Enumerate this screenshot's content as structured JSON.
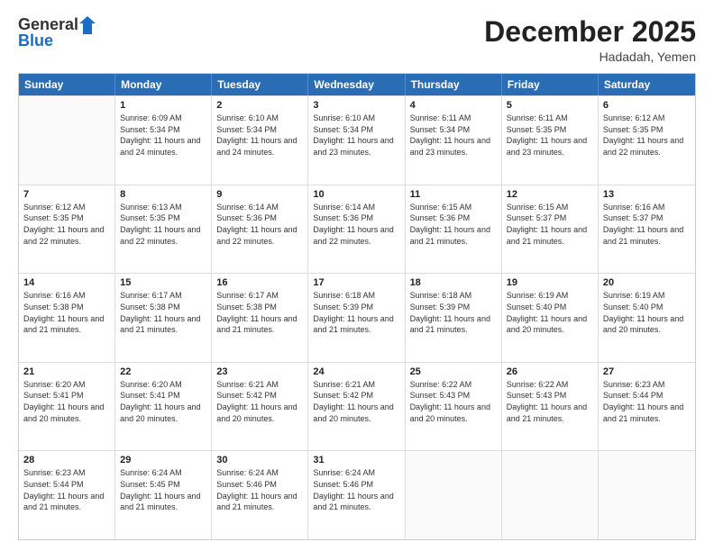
{
  "logo": {
    "general": "General",
    "blue": "Blue"
  },
  "header": {
    "month": "December 2025",
    "location": "Hadadah, Yemen"
  },
  "weekdays": [
    "Sunday",
    "Monday",
    "Tuesday",
    "Wednesday",
    "Thursday",
    "Friday",
    "Saturday"
  ],
  "weeks": [
    [
      {
        "day": null
      },
      {
        "day": "1",
        "sunrise": "6:09 AM",
        "sunset": "5:34 PM",
        "daylight": "11 hours and 24 minutes."
      },
      {
        "day": "2",
        "sunrise": "6:10 AM",
        "sunset": "5:34 PM",
        "daylight": "11 hours and 24 minutes."
      },
      {
        "day": "3",
        "sunrise": "6:10 AM",
        "sunset": "5:34 PM",
        "daylight": "11 hours and 23 minutes."
      },
      {
        "day": "4",
        "sunrise": "6:11 AM",
        "sunset": "5:34 PM",
        "daylight": "11 hours and 23 minutes."
      },
      {
        "day": "5",
        "sunrise": "6:11 AM",
        "sunset": "5:35 PM",
        "daylight": "11 hours and 23 minutes."
      },
      {
        "day": "6",
        "sunrise": "6:12 AM",
        "sunset": "5:35 PM",
        "daylight": "11 hours and 22 minutes."
      }
    ],
    [
      {
        "day": "7",
        "sunrise": "6:12 AM",
        "sunset": "5:35 PM",
        "daylight": "11 hours and 22 minutes."
      },
      {
        "day": "8",
        "sunrise": "6:13 AM",
        "sunset": "5:35 PM",
        "daylight": "11 hours and 22 minutes."
      },
      {
        "day": "9",
        "sunrise": "6:14 AM",
        "sunset": "5:36 PM",
        "daylight": "11 hours and 22 minutes."
      },
      {
        "day": "10",
        "sunrise": "6:14 AM",
        "sunset": "5:36 PM",
        "daylight": "11 hours and 22 minutes."
      },
      {
        "day": "11",
        "sunrise": "6:15 AM",
        "sunset": "5:36 PM",
        "daylight": "11 hours and 21 minutes."
      },
      {
        "day": "12",
        "sunrise": "6:15 AM",
        "sunset": "5:37 PM",
        "daylight": "11 hours and 21 minutes."
      },
      {
        "day": "13",
        "sunrise": "6:16 AM",
        "sunset": "5:37 PM",
        "daylight": "11 hours and 21 minutes."
      }
    ],
    [
      {
        "day": "14",
        "sunrise": "6:16 AM",
        "sunset": "5:38 PM",
        "daylight": "11 hours and 21 minutes."
      },
      {
        "day": "15",
        "sunrise": "6:17 AM",
        "sunset": "5:38 PM",
        "daylight": "11 hours and 21 minutes."
      },
      {
        "day": "16",
        "sunrise": "6:17 AM",
        "sunset": "5:38 PM",
        "daylight": "11 hours and 21 minutes."
      },
      {
        "day": "17",
        "sunrise": "6:18 AM",
        "sunset": "5:39 PM",
        "daylight": "11 hours and 21 minutes."
      },
      {
        "day": "18",
        "sunrise": "6:18 AM",
        "sunset": "5:39 PM",
        "daylight": "11 hours and 21 minutes."
      },
      {
        "day": "19",
        "sunrise": "6:19 AM",
        "sunset": "5:40 PM",
        "daylight": "11 hours and 20 minutes."
      },
      {
        "day": "20",
        "sunrise": "6:19 AM",
        "sunset": "5:40 PM",
        "daylight": "11 hours and 20 minutes."
      }
    ],
    [
      {
        "day": "21",
        "sunrise": "6:20 AM",
        "sunset": "5:41 PM",
        "daylight": "11 hours and 20 minutes."
      },
      {
        "day": "22",
        "sunrise": "6:20 AM",
        "sunset": "5:41 PM",
        "daylight": "11 hours and 20 minutes."
      },
      {
        "day": "23",
        "sunrise": "6:21 AM",
        "sunset": "5:42 PM",
        "daylight": "11 hours and 20 minutes."
      },
      {
        "day": "24",
        "sunrise": "6:21 AM",
        "sunset": "5:42 PM",
        "daylight": "11 hours and 20 minutes."
      },
      {
        "day": "25",
        "sunrise": "6:22 AM",
        "sunset": "5:43 PM",
        "daylight": "11 hours and 20 minutes."
      },
      {
        "day": "26",
        "sunrise": "6:22 AM",
        "sunset": "5:43 PM",
        "daylight": "11 hours and 21 minutes."
      },
      {
        "day": "27",
        "sunrise": "6:23 AM",
        "sunset": "5:44 PM",
        "daylight": "11 hours and 21 minutes."
      }
    ],
    [
      {
        "day": "28",
        "sunrise": "6:23 AM",
        "sunset": "5:44 PM",
        "daylight": "11 hours and 21 minutes."
      },
      {
        "day": "29",
        "sunrise": "6:24 AM",
        "sunset": "5:45 PM",
        "daylight": "11 hours and 21 minutes."
      },
      {
        "day": "30",
        "sunrise": "6:24 AM",
        "sunset": "5:46 PM",
        "daylight": "11 hours and 21 minutes."
      },
      {
        "day": "31",
        "sunrise": "6:24 AM",
        "sunset": "5:46 PM",
        "daylight": "11 hours and 21 minutes."
      },
      {
        "day": null
      },
      {
        "day": null
      },
      {
        "day": null
      }
    ]
  ],
  "labels": {
    "sunrise": "Sunrise:",
    "sunset": "Sunset:",
    "daylight": "Daylight:"
  }
}
